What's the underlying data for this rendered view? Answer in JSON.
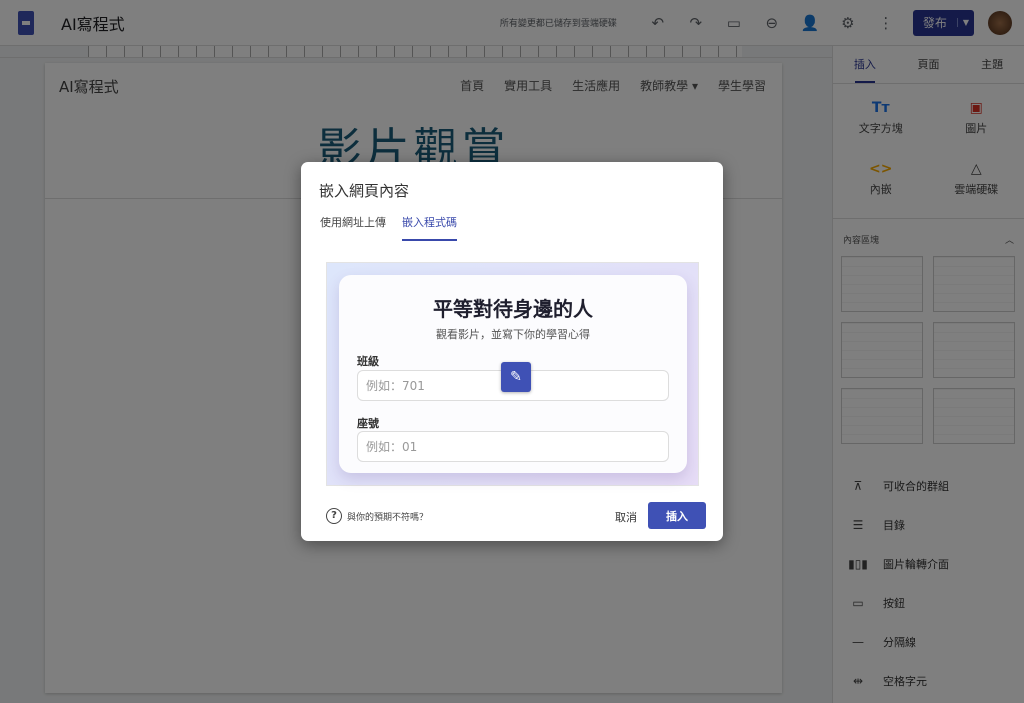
{
  "header": {
    "app_title": "AI寫程式",
    "saved_status": "所有變更都已儲存到雲端硬碟",
    "publish_label": "發布"
  },
  "page": {
    "site_name": "AI寫程式",
    "nav": [
      "首頁",
      "實用工具",
      "生活應用",
      "教師教學 ▾",
      "學生學習"
    ],
    "hero": "影片觀賞"
  },
  "panel": {
    "tabs": [
      "插入",
      "頁面",
      "主題"
    ],
    "insert_items": [
      {
        "label": "文字方塊",
        "icon": "Tт",
        "color": "#1a73e8"
      },
      {
        "label": "圖片",
        "icon": "▣",
        "color": "#d93025"
      },
      {
        "label": "內嵌",
        "icon": "<>",
        "color": "#f9ab00"
      },
      {
        "label": "雲端硬碟",
        "icon": "△",
        "color": "#444444"
      }
    ],
    "section_label": "內容區塊",
    "list": [
      {
        "icon": "⊼",
        "label": "可收合的群組"
      },
      {
        "icon": "☰",
        "label": "目錄"
      },
      {
        "icon": "▮▯▮",
        "label": "圖片輪轉介面"
      },
      {
        "icon": "▭",
        "label": "按鈕"
      },
      {
        "icon": "—",
        "label": "分隔線"
      },
      {
        "icon": "⇹",
        "label": "空格字元"
      }
    ]
  },
  "dialog": {
    "title": "嵌入網頁內容",
    "tabs": [
      "使用網址上傳",
      "嵌入程式碼"
    ],
    "preview": {
      "title": "平等對待身邊的人",
      "subtitle": "觀看影片，並寫下你的學習心得",
      "field1_label": "班級",
      "field1_placeholder": "例如：701",
      "field2_label": "座號",
      "field2_placeholder": "例如：01"
    },
    "help": "與你的預期不符嗎？",
    "cancel": "取消",
    "insert": "插入"
  }
}
